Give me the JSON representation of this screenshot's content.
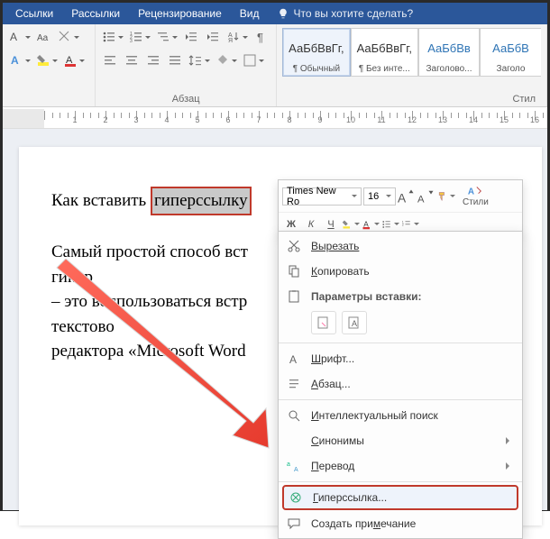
{
  "tabs": {
    "items": [
      "Ссылки",
      "Рассылки",
      "Рецензирование",
      "Вид"
    ],
    "tell_me": "Что вы хотите сделать?"
  },
  "ribbon": {
    "paragraph_label": "Абзац",
    "styles_label": "Стил",
    "styles": [
      {
        "sample": "АаБбВвГг,",
        "name": "¶ Обычный"
      },
      {
        "sample": "АаБбВвГг,",
        "name": "¶ Без инте..."
      },
      {
        "sample": "АаБбВв",
        "name": "Заголово..."
      },
      {
        "sample": "АаБбВ",
        "name": "Заголо"
      }
    ]
  },
  "mini": {
    "font": "Times New Ro",
    "size": "16",
    "styles_label": "Стили",
    "bold": "Ж",
    "italic": "К",
    "underline": "Ч"
  },
  "doc": {
    "title_pre": "Как вставить ",
    "title_sel": "гиперссылку",
    "body1": "Самый простой способ вст",
    "body1b": "кумент гипер",
    "body2": "– это воспользоваться встр",
    "body2b": "ами текстово",
    "body3": "редактора «Microsoft Word"
  },
  "ctx": {
    "cut": "Вырезать",
    "copy": "Копировать",
    "paste_header": "Параметры вставки:",
    "font": "Шрифт...",
    "para": "Абзац...",
    "smart": "Интеллектуальный поиск",
    "syn": "Синонимы",
    "trans": "Перевод",
    "link": "Гиперссылка...",
    "comment": "Создать примечание"
  }
}
